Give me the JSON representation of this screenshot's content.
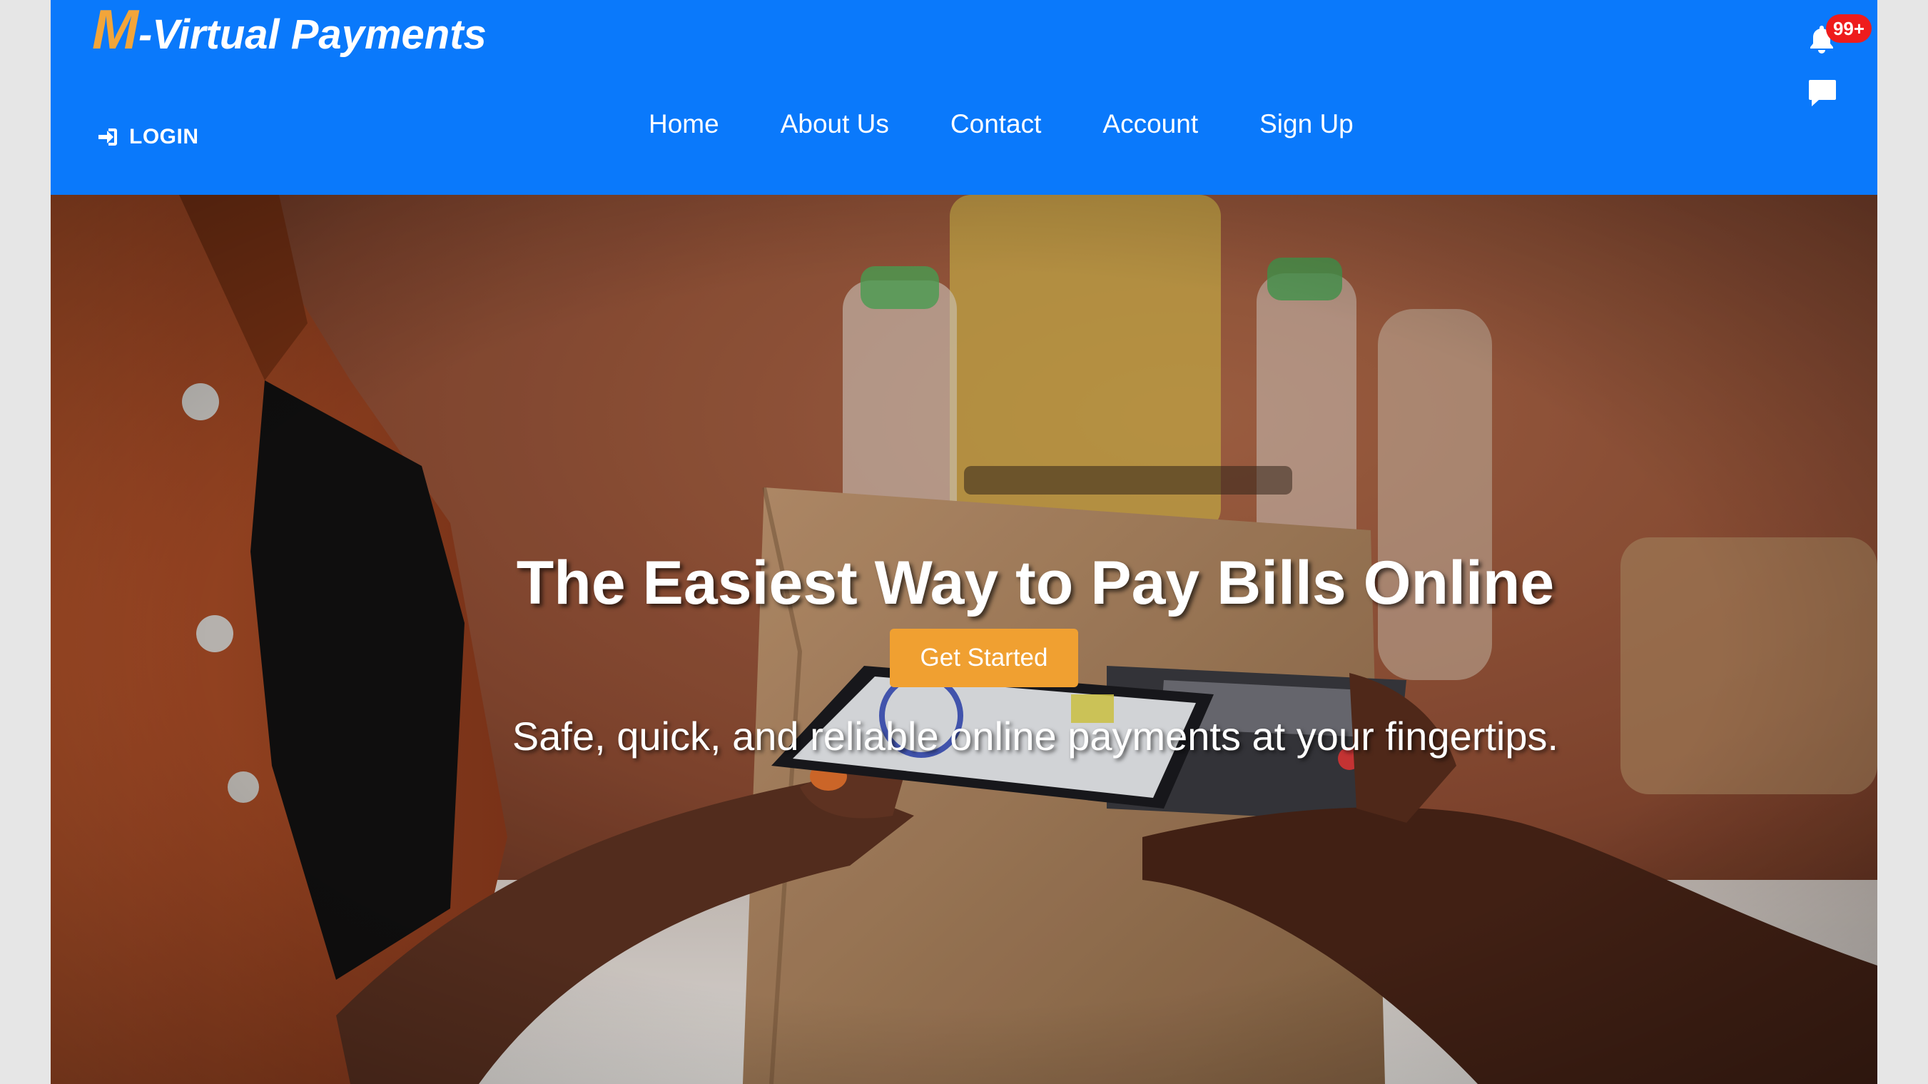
{
  "brand": {
    "initial": "M",
    "rest": "-Virtual Payments"
  },
  "header": {
    "login_label": "LOGIN",
    "nav": [
      "Home",
      "About Us",
      "Contact",
      "Account",
      "Sign Up"
    ],
    "notification_count": "99+"
  },
  "hero": {
    "title": "The Easiest Way to Pay Bills Online",
    "subtitle": "Safe, quick, and reliable online payments at your fingertips.",
    "cta_label": "Get Started"
  },
  "colors": {
    "header_bg": "#0a79fb",
    "brand_accent": "#f2a53a",
    "cta_bg": "#f0a031",
    "badge_bg": "#ee1c1c"
  },
  "icons": {
    "login": "sign-in-icon",
    "notifications": "bell-icon",
    "messages": "chat-icon"
  }
}
